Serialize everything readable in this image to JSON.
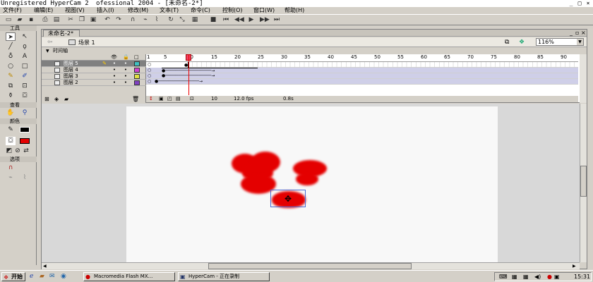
{
  "window": {
    "watermark": "Unregistered HyperCam 2",
    "title_rest": "ofessional 2004 - [未命名-2*]",
    "minimize": "_",
    "maximize": "□",
    "close": "×"
  },
  "menu": [
    "文件(F)",
    "编辑(E)",
    "视图(V)",
    "插入(I)",
    "修改(M)",
    "文本(T)",
    "命令(C)",
    "控制(O)",
    "窗口(W)",
    "帮助(H)"
  ],
  "tools_panel": {
    "title": "工具",
    "view_label": "查看",
    "colors_label": "颜色",
    "options_label": "选项"
  },
  "document": {
    "tab": "未命名-2*",
    "scene": "场景 1",
    "zoom": "116%"
  },
  "timeline": {
    "title": "时间轴",
    "ruler": [
      "1",
      "5",
      "10",
      "15",
      "20",
      "25",
      "30",
      "35",
      "40",
      "45",
      "50",
      "55",
      "60",
      "65",
      "70",
      "75",
      "80",
      "85",
      "90"
    ],
    "layers": [
      {
        "name": "图层 5",
        "color": "#40c0c0"
      },
      {
        "name": "图层 4",
        "color": "#d040d0"
      },
      {
        "name": "图层 3",
        "color": "#e0e040"
      },
      {
        "name": "图层 2",
        "color": "#8040c0"
      }
    ],
    "current_frame": "10",
    "fps": "12.0 fps",
    "elapsed": "0.8s"
  },
  "taskbar": {
    "start": "开始",
    "tasks": [
      "Macromedia Flash MX...",
      "HyperCam - 正在录制"
    ],
    "clock": "15:31"
  },
  "colors": {
    "heart": "#e40000",
    "stage": "#f8f8f8"
  }
}
